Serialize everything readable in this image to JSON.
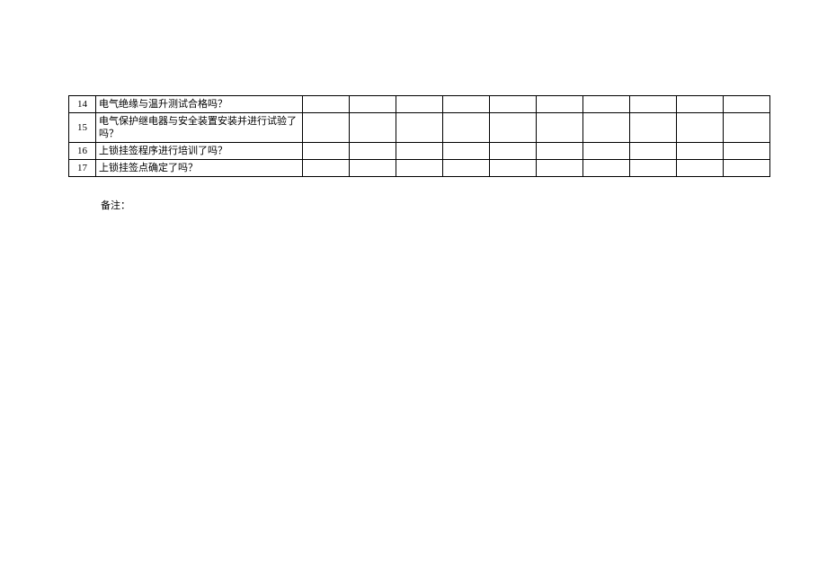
{
  "rows": [
    {
      "num": "14",
      "question": "电气绝缘与温升测试合格吗？"
    },
    {
      "num": "15",
      "question": "电气保护继电器与安全装置安装并进行试验了吗？"
    },
    {
      "num": "16",
      "question": "上锁挂签程序进行培训了吗？"
    },
    {
      "num": "17",
      "question": "上锁挂签点确定了吗？"
    }
  ],
  "footnote": "备注："
}
